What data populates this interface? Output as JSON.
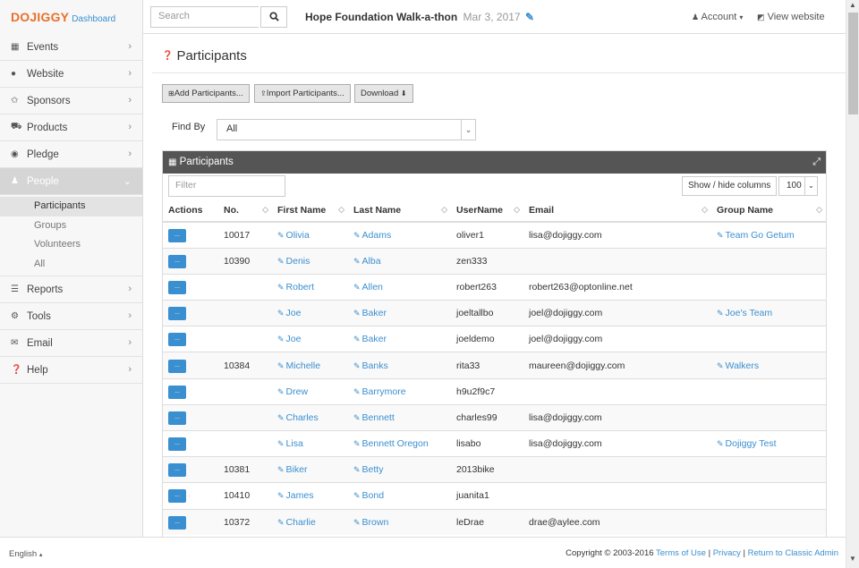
{
  "header": {
    "brand": "DOJIGGY",
    "brand_sub": "Dashboard",
    "search_placeholder": "Search",
    "event_name": "Hope Foundation Walk-a-thon",
    "event_date": "Mar 3, 2017",
    "account_label": "Account",
    "view_website_label": "View website"
  },
  "sidebar": {
    "items": [
      {
        "label": "Events",
        "icon": "calendar-icon"
      },
      {
        "label": "Website",
        "icon": "globe-icon"
      },
      {
        "label": "Sponsors",
        "icon": "star-icon"
      },
      {
        "label": "Products",
        "icon": "cart-icon"
      },
      {
        "label": "Pledge",
        "icon": "target-icon"
      },
      {
        "label": "People",
        "icon": "users-icon"
      },
      {
        "label": "Reports",
        "icon": "list-icon"
      },
      {
        "label": "Tools",
        "icon": "cogs-icon"
      },
      {
        "label": "Email",
        "icon": "envelope-icon"
      },
      {
        "label": "Help",
        "icon": "question-icon"
      }
    ],
    "people_sub": [
      "Participants",
      "Groups",
      "Volunteers",
      "All"
    ]
  },
  "main": {
    "title": "Participants",
    "buttons": {
      "add": "Add Participants...",
      "import": "Import Participants...",
      "download": "Download"
    },
    "find_by_label": "Find By",
    "find_by_value": "All",
    "panel_title": "Participants",
    "filter_placeholder": "Filter",
    "show_hide_label": "Show / hide columns",
    "page_size": "100",
    "columns": [
      "Actions",
      "No.",
      "First Name",
      "Last Name",
      "UserName",
      "Email",
      "Group Name"
    ],
    "action_label": "...",
    "rows": [
      {
        "no": "10017",
        "first": "Olivia",
        "last": "Adams",
        "user": "oliver1",
        "email": "lisa@dojiggy.com",
        "group": "Team Go Getum"
      },
      {
        "no": "10390",
        "first": "Denis",
        "last": "Alba",
        "user": "zen333",
        "email": "",
        "group": ""
      },
      {
        "no": "",
        "first": "Robert",
        "last": "Allen",
        "user": "robert263",
        "email": "robert263@optonline.net",
        "group": ""
      },
      {
        "no": "",
        "first": "Joe",
        "last": "Baker",
        "user": "joeltallbo",
        "email": "joel@dojiggy.com",
        "group": "Joe's Team"
      },
      {
        "no": "",
        "first": "Joe",
        "last": "Baker",
        "user": "joeldemo",
        "email": "joel@dojiggy.com",
        "group": ""
      },
      {
        "no": "10384",
        "first": "Michelle",
        "last": "Banks",
        "user": "rita33",
        "email": "maureen@dojiggy.com",
        "group": "Walkers"
      },
      {
        "no": "",
        "first": "Drew",
        "last": "Barrymore",
        "user": "h9u2f9c7",
        "email": "",
        "group": ""
      },
      {
        "no": "",
        "first": "Charles",
        "last": "Bennett",
        "user": "charles99",
        "email": "lisa@dojiggy.com",
        "group": ""
      },
      {
        "no": "",
        "first": "Lisa",
        "last": "Bennett Oregon",
        "user": "lisabo",
        "email": "lisa@dojiggy.com",
        "group": "Dojiggy Test"
      },
      {
        "no": "10381",
        "first": "Biker",
        "last": "Betty",
        "user": "2013bike",
        "email": "",
        "group": ""
      },
      {
        "no": "10410",
        "first": "James",
        "last": "Bond",
        "user": "juanita1",
        "email": "",
        "group": ""
      },
      {
        "no": "10372",
        "first": "Charlie",
        "last": "Brown",
        "user": "leDrae",
        "email": "drae@aylee.com",
        "group": ""
      }
    ]
  },
  "footer": {
    "language": "English",
    "copyright": "Copyright © 2003-2016",
    "links": [
      "Terms of Use",
      "Privacy",
      "Return to Classic Admin"
    ]
  },
  "colors": {
    "brand": "#e8702a",
    "link": "#3a8fd0",
    "panel_header": "#555555"
  }
}
